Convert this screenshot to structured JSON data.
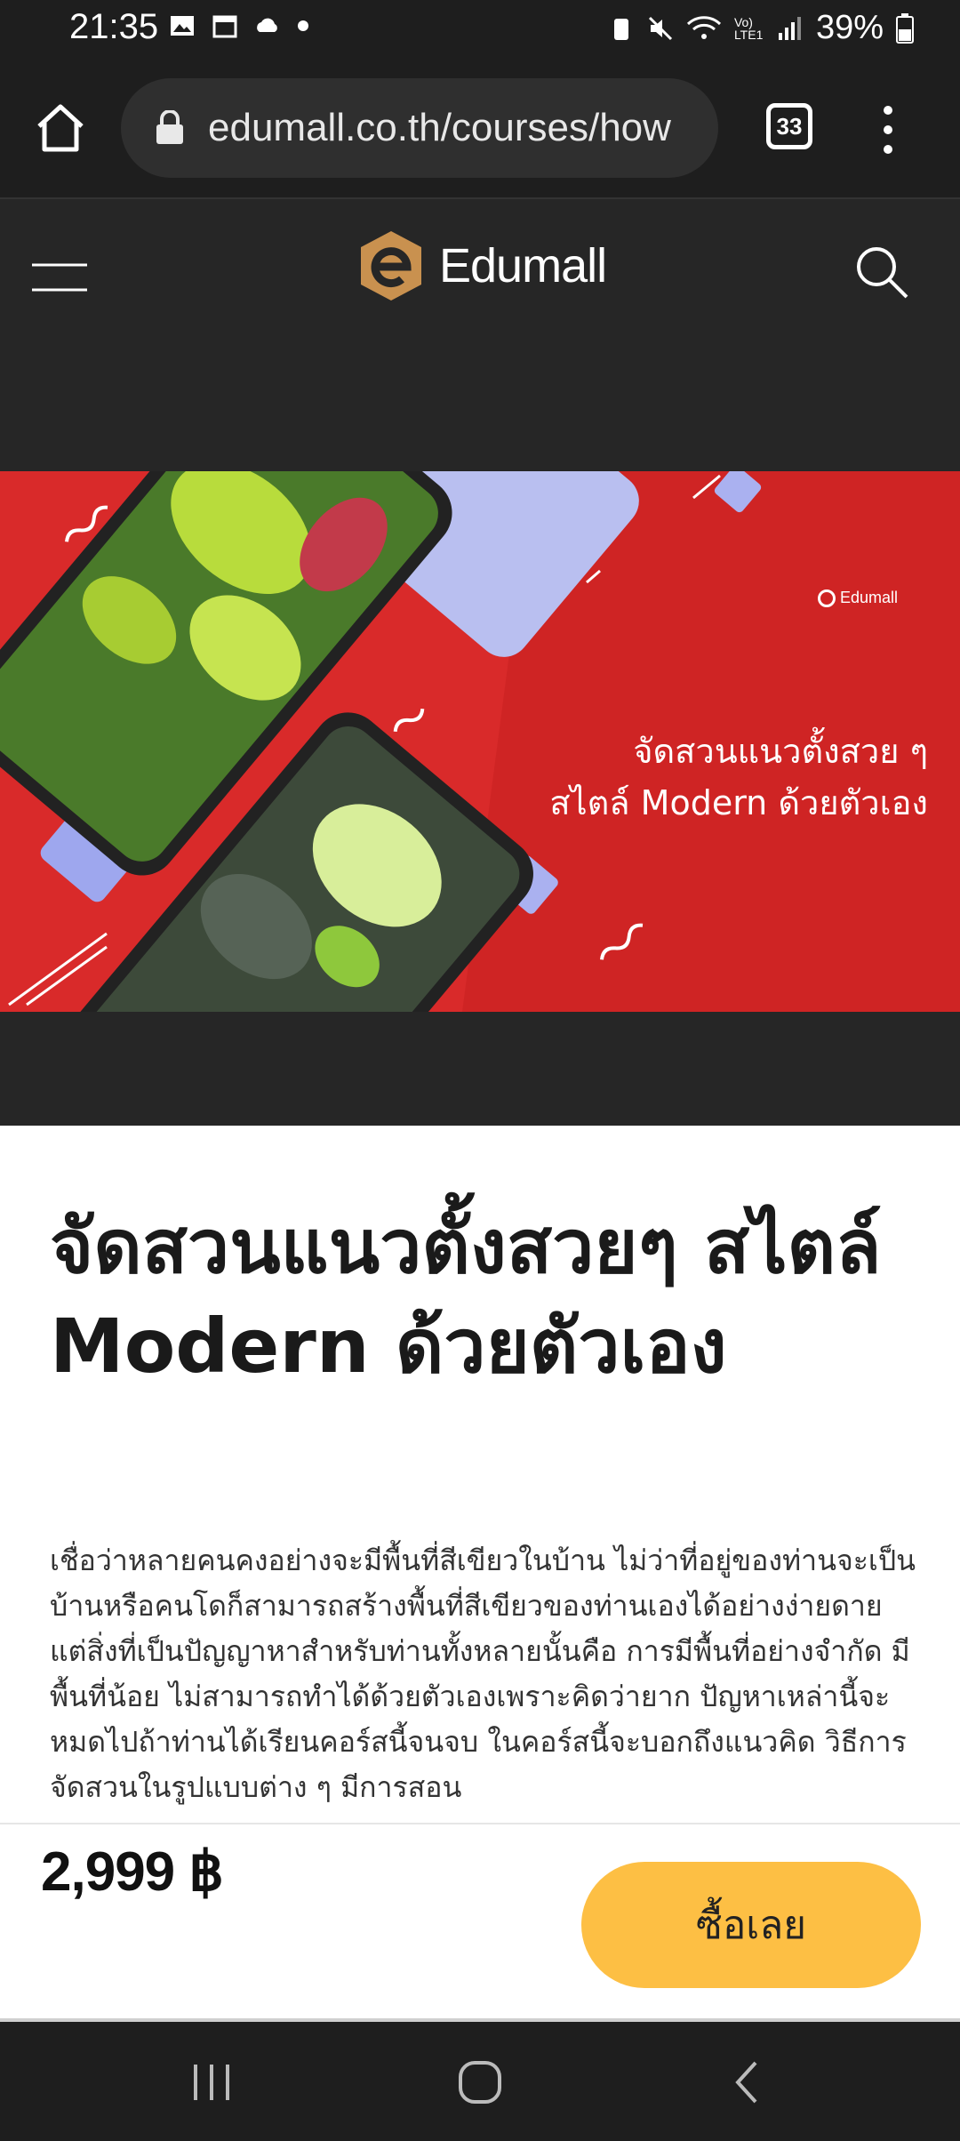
{
  "status_bar": {
    "time": "21:35",
    "battery": "39%",
    "network": "Vo) LTE1"
  },
  "browser": {
    "url": "edumall.co.th/courses/how",
    "tab_count": "33"
  },
  "site": {
    "logo_text": "Edumall"
  },
  "banner": {
    "line1": "จัดสวนแนวตั้งสวย ๆ",
    "line2": "สไตล์ Modern ด้วยตัวเอง",
    "watermark": "Edumall",
    "background_color": "#d92a2a"
  },
  "course": {
    "title": "จัดสวนแนวตั้งสวยๆ สไตล์ Modern ด้วยตัวเอง",
    "description": "เชื่อว่าหลายคนคงอย่างจะมีพื้นที่สีเขียวในบ้าน ไม่ว่าที่อยู่ของท่านจะเป็นบ้านหรือคนโดก็สามารถสร้างพื้นที่สีเขียวของท่านเองได้อย่างง่ายดาย แต่สิ่งที่เป็นปัญญาหาสำหรับท่านทั้งหลายนั้นคือ การมีพื้นที่อย่างจำกัด มีพื้นที่น้อย ไม่สามารถทำได้ด้วยตัวเองเพราะคิดว่ายาก ปัญหาเหล่านี้จะหมดไปถ้าท่านได้เรียนคอร์สนี้จนจบ ในคอร์สนี้จะบอกถึงแนวคิด วิธีการจัดสวนในรูปแบบต่าง ๆ มีการสอน"
  },
  "purchase": {
    "price": "2,999 ฿",
    "buy_label": "ซื้อเลย",
    "button_color": "#fdbf44"
  },
  "icons": [
    "home-icon",
    "lock-icon",
    "tabs-icon",
    "more-vert-icon",
    "hamburger-icon",
    "search-icon",
    "recents-icon",
    "home-nav-icon",
    "back-icon"
  ]
}
